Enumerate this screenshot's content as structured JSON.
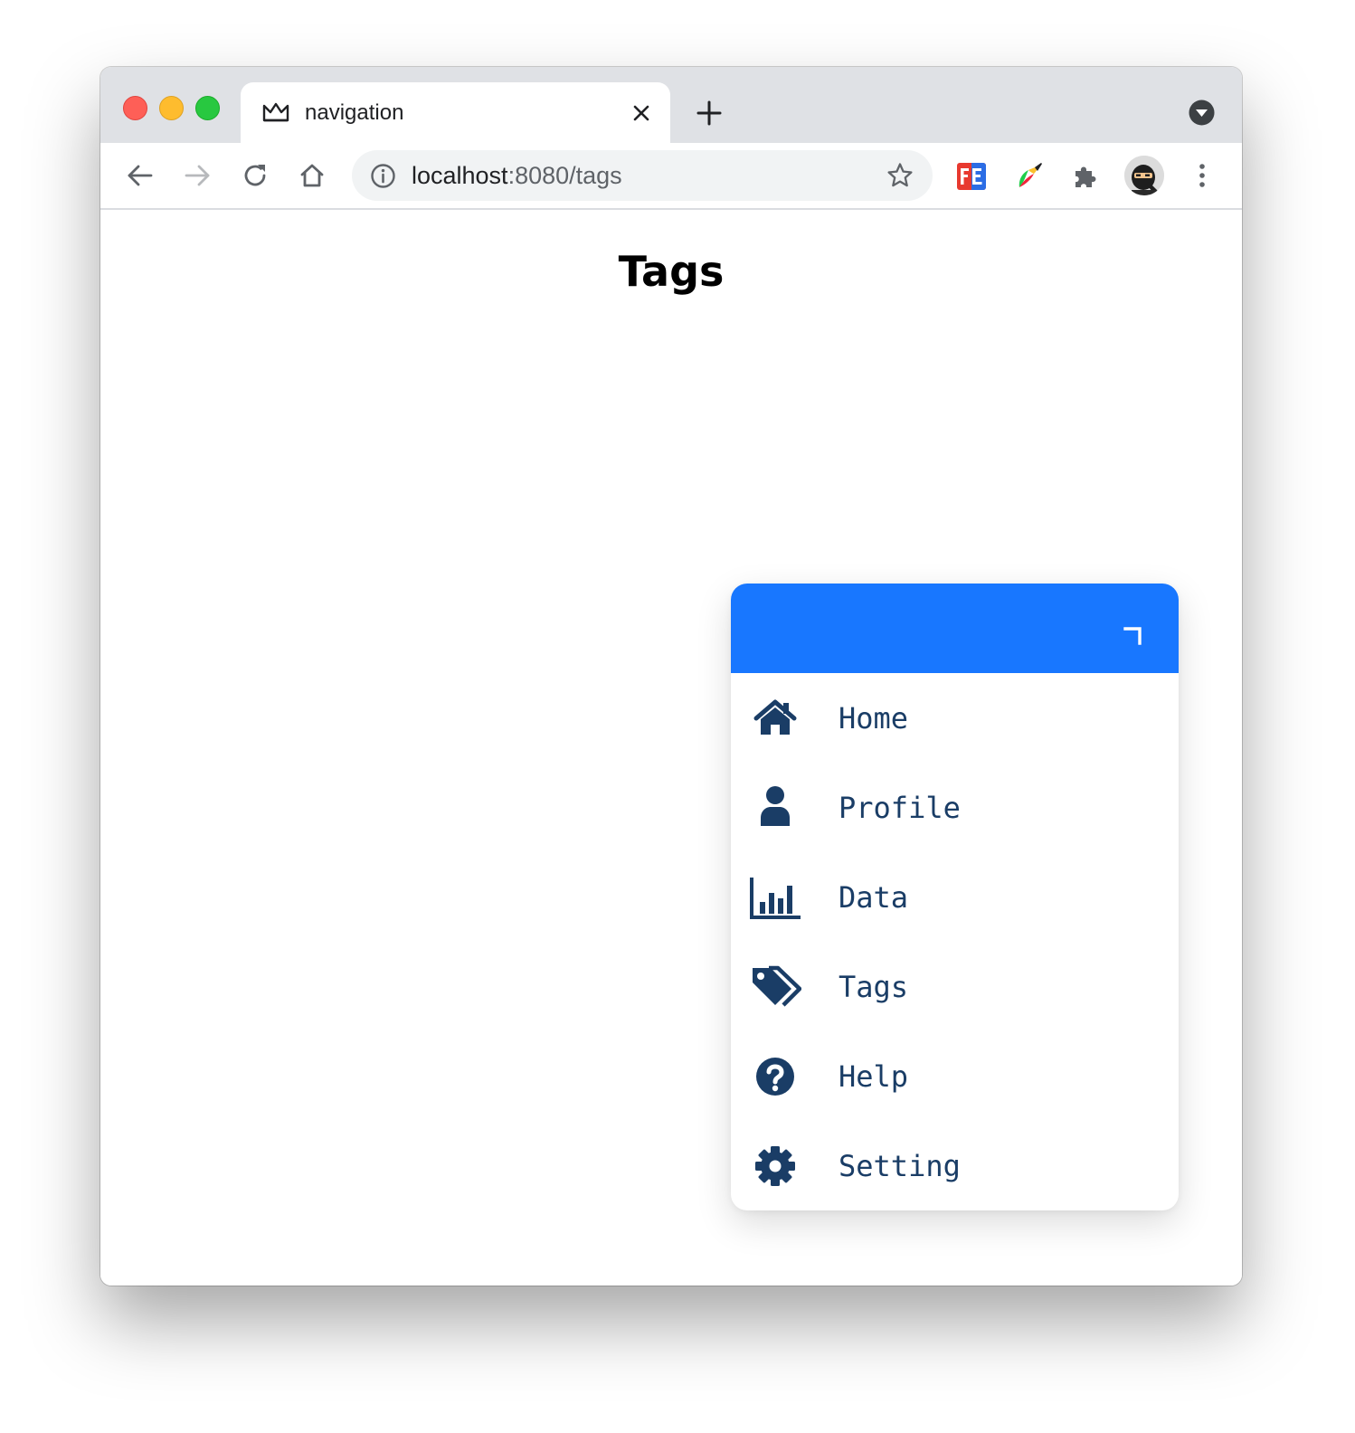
{
  "browser": {
    "tab": {
      "title": "navigation",
      "favicon": "crown-icon"
    },
    "address_bar": {
      "host": "localhost",
      "path": ":8080/tags"
    },
    "icons": {
      "back": "arrow-left-icon",
      "forward": "arrow-right-icon",
      "reload": "reload-icon",
      "home": "home-icon",
      "info": "info-icon",
      "bookmark": "star-icon",
      "extensions": "puzzle-icon",
      "menu": "kebab-menu-icon"
    }
  },
  "page": {
    "heading": "Tags"
  },
  "nav_menu": {
    "header_color": "#1877ff",
    "text_color": "#1a3d66",
    "items": [
      {
        "label": "Home",
        "icon": "home-icon"
      },
      {
        "label": "Profile",
        "icon": "user-icon"
      },
      {
        "label": "Data",
        "icon": "chart-bar-icon"
      },
      {
        "label": "Tags",
        "icon": "tags-icon"
      },
      {
        "label": "Help",
        "icon": "question-circle-icon"
      },
      {
        "label": "Setting",
        "icon": "gear-icon"
      }
    ]
  }
}
